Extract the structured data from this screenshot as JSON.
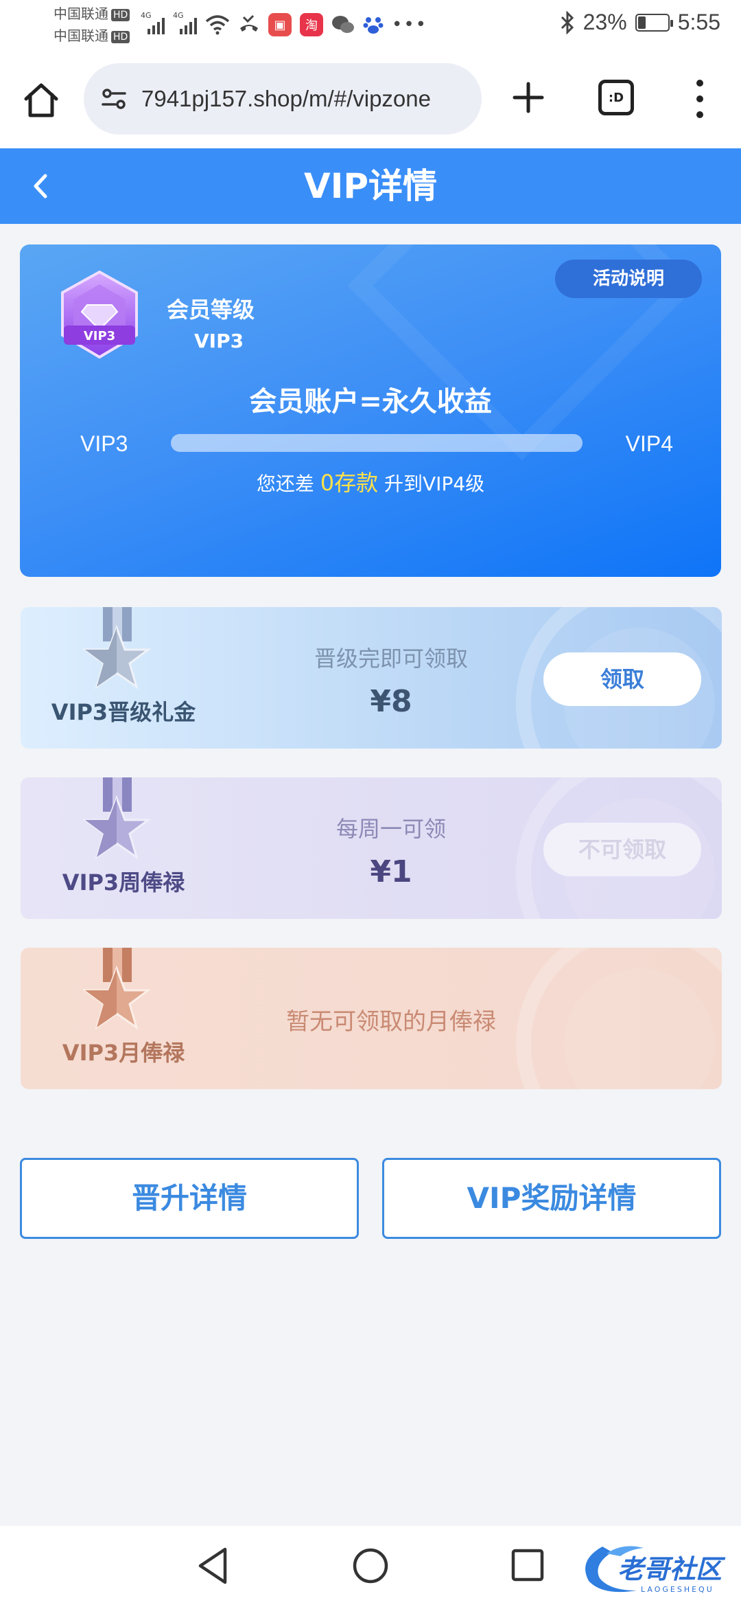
{
  "status_bar": {
    "carrier_1": "中国联通",
    "carrier_2": "中国联通",
    "hd_badge": "HD",
    "network_type": "4G",
    "battery_percent": "23%",
    "time": "5:55",
    "icons": [
      "signal-icon",
      "wifi-icon",
      "missed-call-icon",
      "huawei-app-icon",
      "taobao-icon",
      "wechat-icon",
      "baidu-icon",
      "more-icon",
      "bluetooth-icon",
      "battery-icon"
    ]
  },
  "browser": {
    "url": "7941pj157.shop/m/#/vipzone",
    "tab_label": ":D"
  },
  "header": {
    "title": "VIP详情"
  },
  "vip_card": {
    "rules_button": "活动说明",
    "level_label": "会员等级",
    "level_value": "VIP3",
    "badge_text": "VIP3",
    "slogan": "会员账户=永久收益",
    "current_level": "VIP3",
    "next_level": "VIP4",
    "progress_fraction": 0,
    "hint_before": "您还差",
    "hint_highlight": "0存款",
    "hint_after": "升到VIP4级"
  },
  "rewards": [
    {
      "name": "VIP3晋级礼金",
      "desc": "晋级完即可领取",
      "amount": "¥8",
      "button": "领取",
      "button_enabled": true
    },
    {
      "name": "VIP3周俸禄",
      "desc": "每周一可领",
      "amount": "¥1",
      "button": "不可领取",
      "button_enabled": false
    },
    {
      "name": "VIP3月俸禄",
      "empty_text": "暂无可领取的月俸禄"
    }
  ],
  "actions": {
    "promotion_details": "晋升详情",
    "reward_details": "VIP奖励详情"
  },
  "colors": {
    "header_blue": "#3a8ef8",
    "accent_yellow": "#ffe14a",
    "button_blue": "#3b8ae0"
  }
}
